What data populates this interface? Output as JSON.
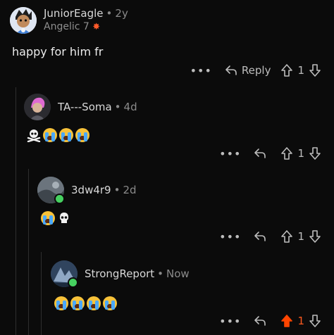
{
  "comments": [
    {
      "username": "JuniorEagle",
      "time": "2y",
      "flair": "Angelic 7",
      "body": "happy for him fr",
      "reply_label": "Reply",
      "score": "1",
      "upvoted": false,
      "online": false,
      "avatar": "cartoon-eagle-avatar"
    },
    {
      "username": "TA---Soma",
      "time": "4d",
      "emojis": [
        "skull-crossbones",
        "crying",
        "crying",
        "crying"
      ],
      "score": "1",
      "upvoted": false,
      "online": false,
      "avatar": "pink-hair-avatar"
    },
    {
      "username": "3dw4r9",
      "time": "2d",
      "emojis": [
        "crying",
        "skull"
      ],
      "score": "1",
      "upvoted": false,
      "online": true,
      "avatar": "grey-photo-avatar"
    },
    {
      "username": "StrongReport",
      "time": "Now",
      "emojis": [
        "crying",
        "crying",
        "crying",
        "crying"
      ],
      "score": "1",
      "upvoted": true,
      "online": true,
      "avatar": "blue-photo-avatar"
    }
  ],
  "colors": {
    "upvote_active": "#ff4500",
    "online": "#46d160",
    "background": "#0b0b0b"
  }
}
